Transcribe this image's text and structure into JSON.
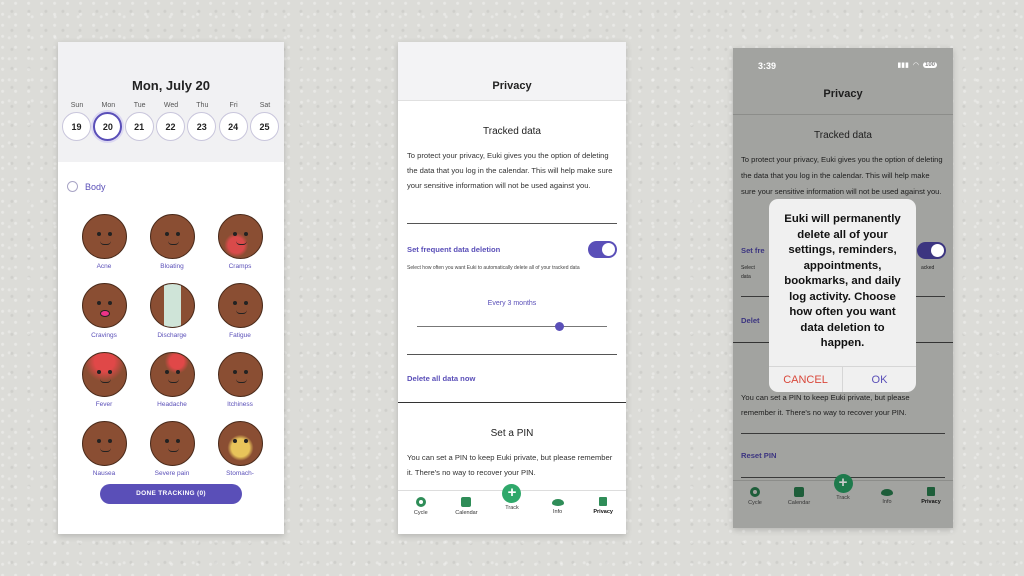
{
  "tracking": {
    "date_title": "Mon, July 20",
    "days": [
      {
        "name": "Sun",
        "num": "19"
      },
      {
        "name": "Mon",
        "num": "20",
        "selected": true
      },
      {
        "name": "Tue",
        "num": "21"
      },
      {
        "name": "Wed",
        "num": "22"
      },
      {
        "name": "Thu",
        "num": "23"
      },
      {
        "name": "Fri",
        "num": "24"
      },
      {
        "name": "Sat",
        "num": "25"
      }
    ],
    "section_label": "Body",
    "symptoms": [
      "Acne",
      "Bloating",
      "Cramps",
      "Cravings",
      "Discharge",
      "Fatigue",
      "Fever",
      "Headache",
      "Itchiness",
      "Nausea",
      "Severe pain",
      "Stomach-"
    ],
    "done_button": "DONE TRACKING (0)"
  },
  "privacy": {
    "title": "Privacy",
    "tracked_heading": "Tracked data",
    "tracked_text": "To protect your privacy, Euki gives you the option of deleting the data that you log in the calendar. This will help make sure your sensitive information will not be used against you.",
    "freq_label": "Set frequent data deletion",
    "freq_desc": "Select how often you want Euki to automatically delete all of your tracked data",
    "freq_value": "Every 3 months",
    "slider_fraction": 0.75,
    "delete_all": "Delete all data now",
    "pin_heading": "Set a PIN",
    "pin_text": "You can set a PIN to keep Euki private, but please remember it. There's no way to recover your PIN."
  },
  "dialog_screen": {
    "time": "3:39",
    "battery": "100",
    "title": "Privacy",
    "tracked_heading": "Tracked data",
    "tracked_text": "To protect your privacy, Euki gives you the option of deleting the data that you log in the calendar. This will help make sure your sensitive information will not be used against you.",
    "freq_label_partial": "Set fre",
    "freq_desc_partial_l": "Select",
    "freq_desc_partial_l2": "data",
    "freq_desc_partial_r": "acked",
    "delete_partial": "Delet",
    "pin_text": "You can set a PIN to keep Euki private, but please remember it. There's no way to recover your PIN.",
    "reset_pin": "Reset PIN",
    "dialog_message": "Euki will permanently delete all of your settings, reminders, appointments, bookmarks, and daily log activity. Choose how often you want data deletion to happen.",
    "cancel": "CANCEL",
    "ok": "OK"
  },
  "tabs": [
    {
      "label": "Cycle",
      "icon": "cycle-icon"
    },
    {
      "label": "Calendar",
      "icon": "calendar-icon"
    },
    {
      "label": "Track",
      "icon": "plus-icon"
    },
    {
      "label": "Info",
      "icon": "eye-icon"
    },
    {
      "label": "Privacy",
      "icon": "lock-icon",
      "active": true
    }
  ],
  "colors": {
    "accent": "#5a4fb8",
    "green": "#2f8d58",
    "cancel": "#d9483b"
  }
}
